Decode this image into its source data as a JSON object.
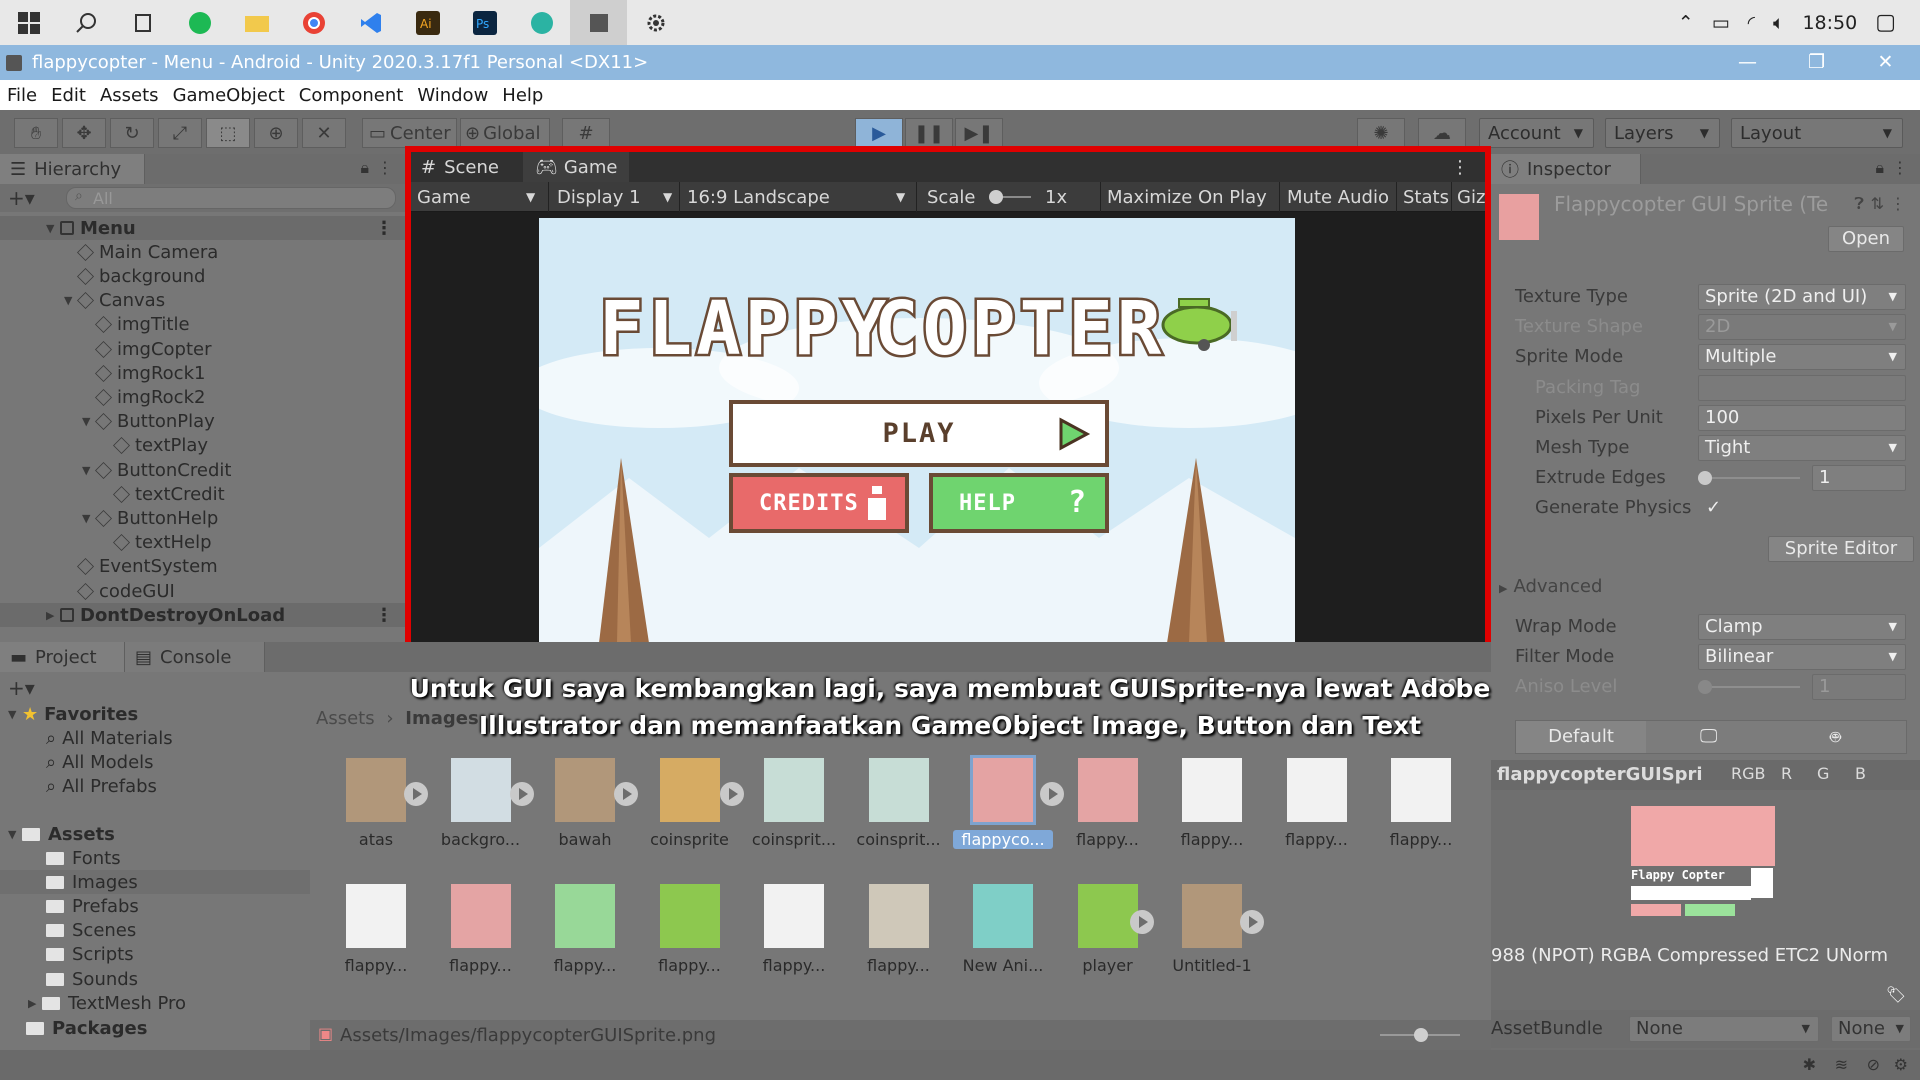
{
  "taskbar": {
    "clock": "18:50"
  },
  "window": {
    "title": "flappycopter - Menu - Android - Unity 2020.3.17f1 Personal <DX11>"
  },
  "menu": [
    "File",
    "Edit",
    "Assets",
    "GameObject",
    "Component",
    "Window",
    "Help"
  ],
  "toolbar": {
    "center": "Center",
    "global": "Global",
    "account": "Account",
    "layers": "Layers",
    "layout": "Layout"
  },
  "hierarchy": {
    "tab": "Hierarchy",
    "search_placeholder": "All",
    "items": [
      {
        "label": "Menu",
        "depth": 0,
        "kind": "scene",
        "expanded": true
      },
      {
        "label": "Main Camera",
        "depth": 1,
        "kind": "obj"
      },
      {
        "label": "background",
        "depth": 1,
        "kind": "obj"
      },
      {
        "label": "Canvas",
        "depth": 1,
        "kind": "obj",
        "expanded": true
      },
      {
        "label": "imgTitle",
        "depth": 2,
        "kind": "obj"
      },
      {
        "label": "imgCopter",
        "depth": 2,
        "kind": "obj"
      },
      {
        "label": "imgRock1",
        "depth": 2,
        "kind": "obj"
      },
      {
        "label": "imgRock2",
        "depth": 2,
        "kind": "obj"
      },
      {
        "label": "ButtonPlay",
        "depth": 2,
        "kind": "obj",
        "expanded": true
      },
      {
        "label": "textPlay",
        "depth": 3,
        "kind": "obj"
      },
      {
        "label": "ButtonCredit",
        "depth": 2,
        "kind": "obj",
        "expanded": true
      },
      {
        "label": "textCredit",
        "depth": 3,
        "kind": "obj"
      },
      {
        "label": "ButtonHelp",
        "depth": 2,
        "kind": "obj",
        "expanded": true
      },
      {
        "label": "textHelp",
        "depth": 3,
        "kind": "obj"
      },
      {
        "label": "EventSystem",
        "depth": 1,
        "kind": "obj"
      },
      {
        "label": "codeGUI",
        "depth": 1,
        "kind": "obj"
      },
      {
        "label": "DontDestroyOnLoad",
        "depth": 0,
        "kind": "scene",
        "expanded": false
      }
    ]
  },
  "game": {
    "tab_scene": "Scene",
    "tab_game": "Game",
    "mode": "Game",
    "display": "Display 1",
    "aspect": "16:9 Landscape",
    "scale_label": "Scale",
    "scale_value": "1x",
    "maximize": "Maximize On Play",
    "mute": "Mute Audio",
    "stats": "Stats",
    "gizmos": "Giz",
    "title_left": "FLAPPY",
    "title_right": "COPTER",
    "play_button": "PLAY",
    "credits_button": "CREDITS",
    "help_button": "HELP"
  },
  "inspector": {
    "tab": "Inspector",
    "asset_name": "Flappycopter GUI Sprite (Te",
    "open_button": "Open",
    "rows": [
      {
        "label": "Texture Type",
        "value": "Sprite (2D and UI)",
        "type": "dropdown",
        "dim": false
      },
      {
        "label": "Texture Shape",
        "value": "2D",
        "type": "dropdown",
        "dim": true
      },
      {
        "label": "Sprite Mode",
        "value": "Multiple",
        "type": "dropdown",
        "dim": false
      },
      {
        "label": "Packing Tag",
        "value": "",
        "type": "text",
        "dim": true
      },
      {
        "label": "Pixels Per Unit",
        "value": "100",
        "type": "text",
        "dim": false
      },
      {
        "label": "Mesh Type",
        "value": "Tight",
        "type": "dropdown",
        "dim": false
      },
      {
        "label": "Extrude Edges",
        "value": "1",
        "type": "slider",
        "dim": false
      },
      {
        "label": "Generate Physics",
        "value": "✓",
        "type": "check",
        "dim": false
      }
    ],
    "sprite_editor": "Sprite Editor",
    "advanced": "Advanced",
    "rows2": [
      {
        "label": "Wrap Mode",
        "value": "Clamp",
        "type": "dropdown",
        "dim": false
      },
      {
        "label": "Filter Mode",
        "value": "Bilinear",
        "type": "dropdown",
        "dim": false
      },
      {
        "label": "Aniso Level",
        "value": "1",
        "type": "slider",
        "dim": true
      }
    ],
    "platform_default": "Default",
    "preview_name": "flappycopterGUISpri",
    "channels": [
      "RGB",
      "R",
      "G",
      "B"
    ],
    "preview_info": "988 (NPOT)  RGBA Compressed ETC2 UNorm",
    "assetbundle_label": "AssetBundle",
    "assetbundle_value": "None",
    "assetbundle_variant": "None"
  },
  "project": {
    "tab_project": "Project",
    "tab_console": "Console",
    "favorites": "Favorites",
    "fav_items": [
      "All Materials",
      "All Models",
      "All Prefabs"
    ],
    "assets_root": "Assets",
    "folders": [
      "Fonts",
      "Images",
      "Prefabs",
      "Scenes",
      "Scripts",
      "Sounds",
      "TextMesh Pro"
    ],
    "packages": "Packages",
    "breadcrumb_root": "Assets",
    "breadcrumb_current": "Images",
    "icon_count": "20",
    "row1": [
      "atas",
      "backgro...",
      "bawah",
      "coinsprite",
      "coinsprit...",
      "coinsprit...",
      "flappyco...",
      "flappy...",
      "flappy...",
      "flappy...",
      "flappy..."
    ],
    "row2": [
      "flappy...",
      "flappy...",
      "flappy...",
      "flappy...",
      "flappy...",
      "flappy...",
      "New Ani...",
      "player",
      "Untitled-1"
    ],
    "path": "Assets/Images/flappycopterGUISprite.png"
  },
  "caption": {
    "line1": "Untuk GUI saya kembangkan lagi, saya membuat GUISprite-nya lewat Adobe",
    "line2": "Illustrator dan memanfaatkan GameObject Image, Button dan Text"
  }
}
